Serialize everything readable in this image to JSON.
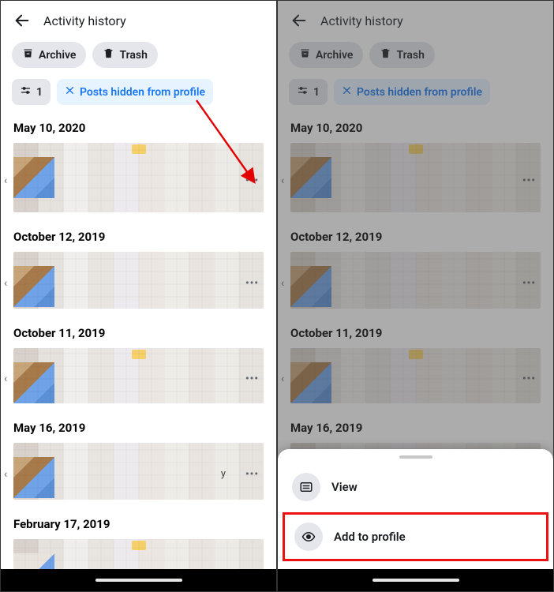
{
  "header": {
    "title": "Activity history"
  },
  "actions": {
    "archive": "Archive",
    "trash": "Trash"
  },
  "filters": {
    "count": "1",
    "hidden_chip": "Posts hidden from profile"
  },
  "dates": {
    "d0": "May 10, 2020",
    "d1": "October 12, 2019",
    "d2": "October 11, 2019",
    "d3": "May 16, 2019",
    "d4": "February 17, 2019"
  },
  "menu": {
    "view": "View",
    "add_to_profile": "Add to profile"
  }
}
